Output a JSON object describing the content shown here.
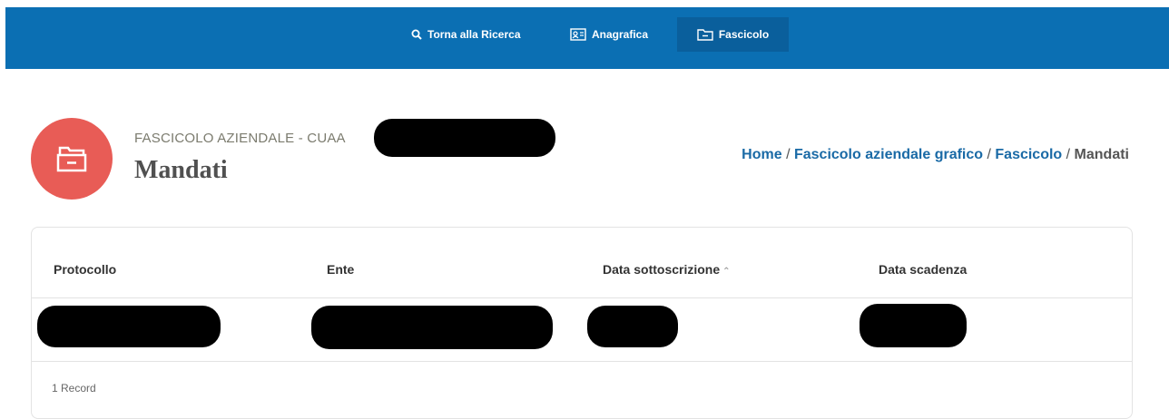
{
  "nav": {
    "search_label": "Torna alla Ricerca",
    "anagrafica_label": "Anagrafica",
    "fascicolo_label": "Fascicolo"
  },
  "header": {
    "subtitle": "FASCICOLO AZIENDALE - CUAA",
    "title": "Mandati",
    "icon": "folder-open-icon"
  },
  "breadcrumb": {
    "items": [
      "Home",
      "Fascicolo aziendale grafico",
      "Fascicolo",
      "Mandati"
    ],
    "separator": "/"
  },
  "table": {
    "columns": [
      "Protocollo",
      "Ente",
      "Data sottoscrizione",
      "Data scadenza"
    ],
    "sorted_column": "Data sottoscrizione",
    "sort_direction": "ascending",
    "rows": [
      {
        "protocollo": "",
        "ente": "",
        "data_sottoscrizione": "",
        "data_scadenza": ""
      }
    ],
    "footer": "1 Record"
  },
  "colors": {
    "topbar": "#0b6fb3",
    "active_tab": "#0a5f9c",
    "header_icon_bg": "#e85c56",
    "link": "#1a6aa6"
  }
}
